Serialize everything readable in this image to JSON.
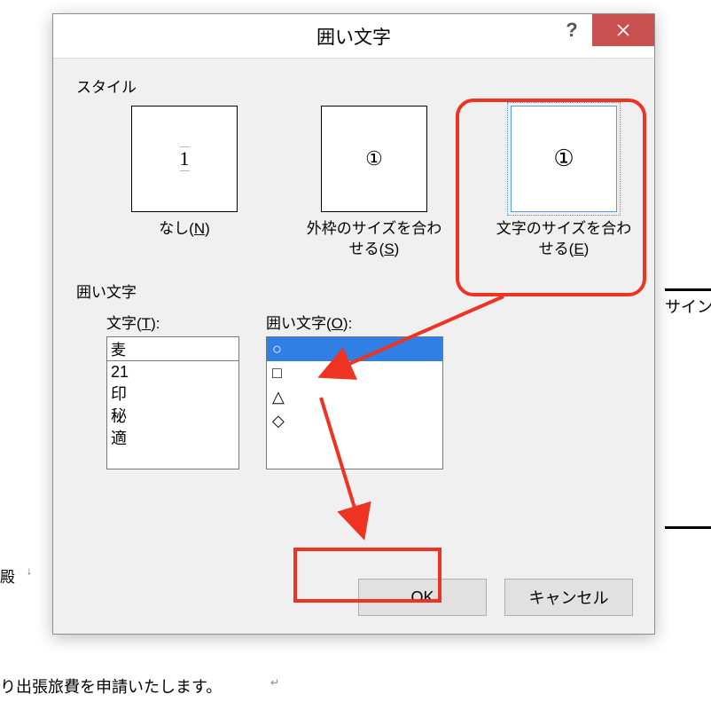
{
  "background": {
    "salutation": "殿",
    "sentence": "り出張旅費を申請いたします。",
    "sign_label": "サイン"
  },
  "dialog": {
    "title": "囲い文字",
    "section_style": "スタイル",
    "styles": {
      "none": {
        "thumb": "1",
        "label_pre": "なし(",
        "mnemonic": "N",
        "label_post": ")"
      },
      "shrink": {
        "thumb": "①",
        "label_pre": "外枠のサイズを合わせる(",
        "mnemonic": "S",
        "label_post": ")"
      },
      "enlarge": {
        "thumb": "①",
        "label_pre": "文字のサイズを合わせる(",
        "mnemonic": "E",
        "label_post": ")"
      }
    },
    "section_enclose": "囲い文字",
    "char_col": {
      "label_pre": "文字(",
      "mnemonic": "T",
      "label_post": "):",
      "input_value": "麦",
      "list": [
        "21",
        "印",
        "秘",
        "適"
      ]
    },
    "enclose_col": {
      "label_pre": "囲い文字(",
      "mnemonic": "O",
      "label_post": "):",
      "list": [
        "○",
        "□",
        "△",
        "◇"
      ],
      "selected_index": 0
    },
    "buttons": {
      "ok": "OK",
      "cancel": "キャンセル"
    }
  }
}
